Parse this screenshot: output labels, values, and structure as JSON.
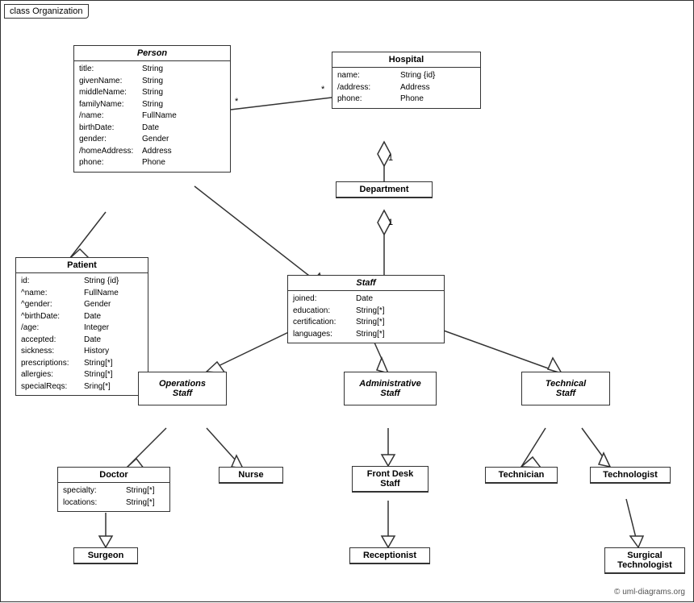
{
  "diagram": {
    "title": "class Organization",
    "copyright": "© uml-diagrams.org",
    "classes": {
      "person": {
        "name": "Person",
        "italic": true,
        "attrs": [
          {
            "name": "title:",
            "type": "String"
          },
          {
            "name": "givenName:",
            "type": "String"
          },
          {
            "name": "middleName:",
            "type": "String"
          },
          {
            "name": "familyName:",
            "type": "String"
          },
          {
            "name": "/name:",
            "type": "FullName"
          },
          {
            "name": "birthDate:",
            "type": "Date"
          },
          {
            "name": "gender:",
            "type": "Gender"
          },
          {
            "name": "/homeAddress:",
            "type": "Address"
          },
          {
            "name": "phone:",
            "type": "Phone"
          }
        ]
      },
      "hospital": {
        "name": "Hospital",
        "italic": false,
        "attrs": [
          {
            "name": "name:",
            "type": "String {id}"
          },
          {
            "name": "/address:",
            "type": "Address"
          },
          {
            "name": "phone:",
            "type": "Phone"
          }
        ]
      },
      "department": {
        "name": "Department",
        "italic": false,
        "attrs": []
      },
      "staff": {
        "name": "Staff",
        "italic": true,
        "attrs": [
          {
            "name": "joined:",
            "type": "Date"
          },
          {
            "name": "education:",
            "type": "String[*]"
          },
          {
            "name": "certification:",
            "type": "String[*]"
          },
          {
            "name": "languages:",
            "type": "String[*]"
          }
        ]
      },
      "patient": {
        "name": "Patient",
        "italic": false,
        "attrs": [
          {
            "name": "id:",
            "type": "String {id}"
          },
          {
            "name": "^name:",
            "type": "FullName"
          },
          {
            "name": "^gender:",
            "type": "Gender"
          },
          {
            "name": "^birthDate:",
            "type": "Date"
          },
          {
            "name": "/age:",
            "type": "Integer"
          },
          {
            "name": "accepted:",
            "type": "Date"
          },
          {
            "name": "sickness:",
            "type": "History"
          },
          {
            "name": "prescriptions:",
            "type": "String[*]"
          },
          {
            "name": "allergies:",
            "type": "String[*]"
          },
          {
            "name": "specialReqs:",
            "type": "Sring[*]"
          }
        ]
      },
      "operations_staff": {
        "name": "Operations\nStaff",
        "italic": true
      },
      "administrative_staff": {
        "name": "Administrative\nStaff",
        "italic": true
      },
      "technical_staff": {
        "name": "Technical\nStaff",
        "italic": true
      },
      "doctor": {
        "name": "Doctor",
        "italic": false,
        "attrs": [
          {
            "name": "specialty:",
            "type": "String[*]"
          },
          {
            "name": "locations:",
            "type": "String[*]"
          }
        ]
      },
      "nurse": {
        "name": "Nurse",
        "italic": false,
        "attrs": []
      },
      "front_desk_staff": {
        "name": "Front Desk\nStaff",
        "italic": false,
        "attrs": []
      },
      "technician": {
        "name": "Technician",
        "italic": false,
        "attrs": []
      },
      "technologist": {
        "name": "Technologist",
        "italic": false,
        "attrs": []
      },
      "surgeon": {
        "name": "Surgeon",
        "italic": false,
        "attrs": []
      },
      "receptionist": {
        "name": "Receptionist",
        "italic": false,
        "attrs": []
      },
      "surgical_technologist": {
        "name": "Surgical\nTechnologist",
        "italic": false,
        "attrs": []
      }
    }
  }
}
